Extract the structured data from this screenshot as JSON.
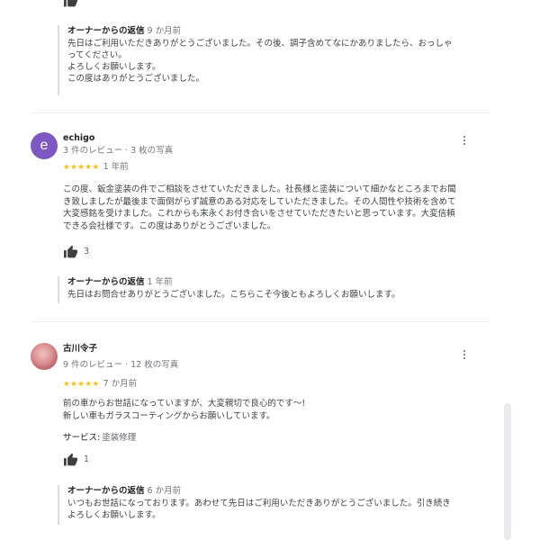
{
  "top_like_icon": "thumb-up-icon",
  "reply_1": {
    "owner_label": "オーナーからの返信",
    "time": "9 か月前",
    "text": "先日はご利用いただきありがとうございました。その後、調子含めてなにかありましたら、おっしゃ\nってください。\nよろしくお願いします。\nこの度はありがとうございました。"
  },
  "review_2": {
    "avatar_letter": "e",
    "name": "echigo",
    "meta": "3 件のレビュー · 3 枚の写真",
    "stars": "★★★★★",
    "age": "1 年前",
    "text": "この度、鈑金塗装の件でご相談をさせていただきました。社長様と塗装について細かなところまでお聞\nき致しましたが最後まで面倒がらず誠意のある対応をしていただきました。その人間性や技術を含めて\n大変感銘を受けました。これからも末永くお付き合いをさせていただきたいと思っています。大変信頼\nできる会社様です。この度はありがとうございました。",
    "likes": "3",
    "reply": {
      "owner_label": "オーナーからの返信",
      "time": "1 年前",
      "text": "先日はお問合せありがとうございました。こちらこそ今後ともよろしくお願いします。"
    }
  },
  "review_3": {
    "name": "古川令子",
    "meta": "9 件のレビュー · 12 枚の写真",
    "stars": "★★★★★",
    "age": "7 か月前",
    "text": "前の車からお世話になっていますが、大変親切で良心的です〜!\n新しい車もガラスコーティングからお願いしています。",
    "service_label": "サービス:",
    "service_value": "塗装修理",
    "likes": "1",
    "reply": {
      "owner_label": "オーナーからの返信",
      "time": "6 か月前",
      "text": "いつもお世話になっております。あわせて先日はご利用いただきありがとうございました。引き続き\nよろしくお願いします。"
    }
  },
  "colors": {
    "star": "#fbbc04",
    "avatar_e": "#7e57c2",
    "reply_border": "#dadce0"
  }
}
